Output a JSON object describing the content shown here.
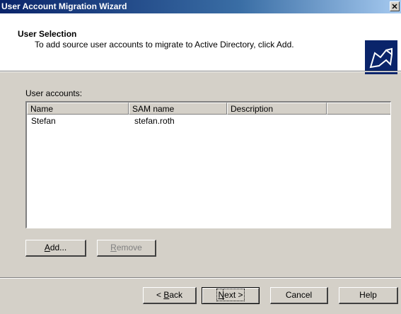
{
  "window": {
    "title": "User Account Migration Wizard",
    "close_glyph": "✕"
  },
  "header": {
    "title": "User Selection",
    "subtitle": "To add source user accounts to migrate to Active Directory, click Add.",
    "icon": "wizard-arrow-icon"
  },
  "accounts": {
    "label": "User accounts:",
    "columns": [
      "Name",
      "SAM name",
      "Description",
      ""
    ],
    "rows": [
      {
        "name": "Stefan",
        "sam_name": "stefan.roth",
        "description": ""
      }
    ]
  },
  "list_buttons": {
    "add": {
      "accel": "A",
      "rest": "dd..."
    },
    "remove": {
      "accel": "R",
      "rest": "emove",
      "disabled": true
    }
  },
  "nav_buttons": {
    "back": {
      "pre": "< ",
      "accel": "B",
      "rest": "ack"
    },
    "next": {
      "accel": "N",
      "rest": "ext >"
    },
    "cancel": "Cancel",
    "help": "Help"
  },
  "colors": {
    "title_gradient_start": "#0a246a",
    "title_gradient_end": "#a6caf0",
    "dialog_face": "#d4d0c8",
    "disabled_text": "#808080"
  }
}
